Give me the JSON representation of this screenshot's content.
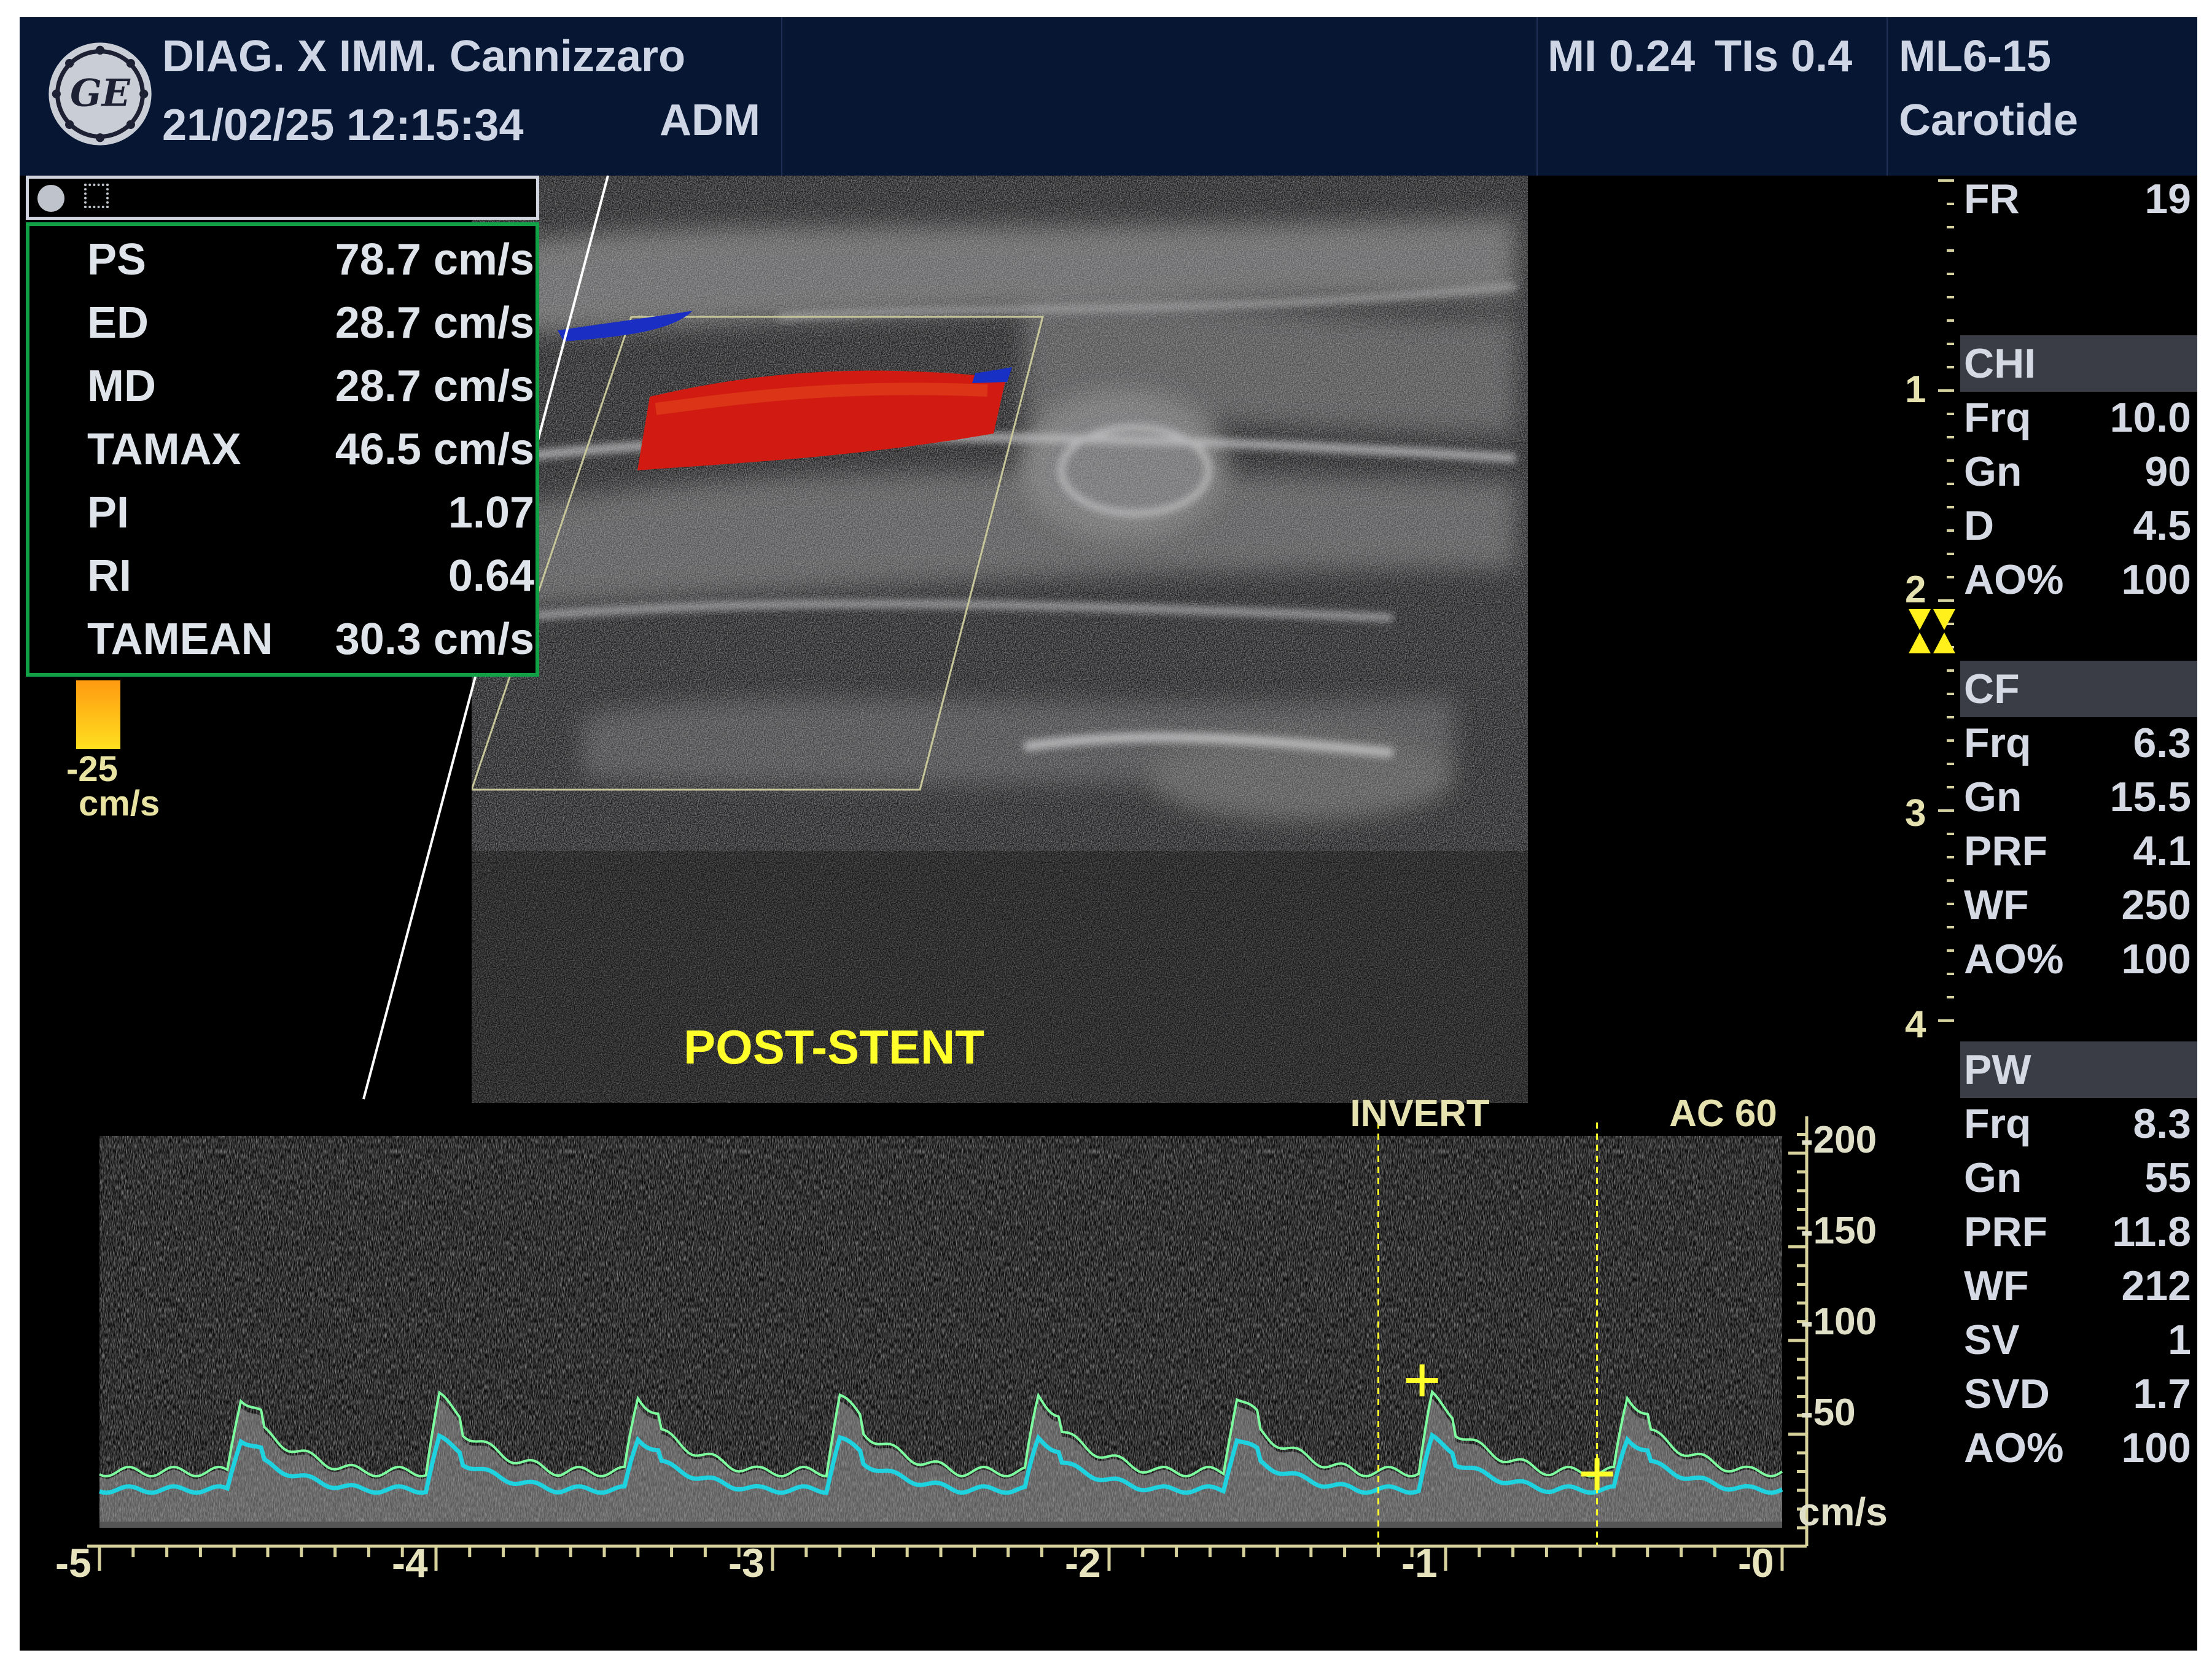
{
  "header": {
    "institution": "DIAG. X IMM. Cannizzaro",
    "datetime": "21/02/25 12:15:34",
    "operator": "ADM",
    "mi": "MI 0.24",
    "tis": "TIs 0.4",
    "probe": "ML6-15",
    "preset": "Carotide"
  },
  "logo_text": "GE",
  "measurements": [
    {
      "label": "PS",
      "value": "78.7 cm/s"
    },
    {
      "label": "ED",
      "value": "28.7 cm/s"
    },
    {
      "label": "MD",
      "value": "28.7 cm/s"
    },
    {
      "label": "TAMAX",
      "value": "46.5 cm/s"
    },
    {
      "label": "PI",
      "value": "1.07"
    },
    {
      "label": "RI",
      "value": "0.64"
    },
    {
      "label": "TAMEAN",
      "value": "30.3 cm/s"
    }
  ],
  "color_scale": {
    "min": "-25",
    "unit": "cm/s"
  },
  "image_annotation": "POST-STENT",
  "doppler": {
    "invert": "INVERT",
    "ac": "AC 60",
    "unit": "cm/s",
    "velocity_ticks": [
      "-200",
      "-150",
      "-100",
      "-50"
    ],
    "velocity_tick_values": [
      -200,
      -150,
      -100,
      -50
    ],
    "time_ticks": [
      "-5",
      "-4",
      "-3",
      "-2",
      "-1",
      "-0"
    ],
    "time_tick_values": [
      -5,
      -4,
      -3,
      -2,
      -1,
      0
    ],
    "cursor_times": [
      -1.2,
      -0.55
    ]
  },
  "depth_marks": [
    "1",
    "2",
    "3",
    "4"
  ],
  "side_panel": {
    "fr": {
      "label": "FR",
      "value": "19"
    },
    "chi": {
      "title": "CHI",
      "rows": [
        {
          "label": "Frq",
          "value": "10.0"
        },
        {
          "label": "Gn",
          "value": "90"
        },
        {
          "label": "D",
          "value": "4.5"
        },
        {
          "label": "AO%",
          "value": "100"
        }
      ]
    },
    "cf": {
      "title": "CF",
      "rows": [
        {
          "label": "Frq",
          "value": "6.3"
        },
        {
          "label": "Gn",
          "value": "15.5"
        },
        {
          "label": "PRF",
          "value": "4.1"
        },
        {
          "label": "WF",
          "value": "250"
        },
        {
          "label": "AO%",
          "value": "100"
        }
      ]
    },
    "pw": {
      "title": "PW",
      "rows": [
        {
          "label": "Frq",
          "value": "8.3"
        },
        {
          "label": "Gn",
          "value": "55"
        },
        {
          "label": "PRF",
          "value": "11.8"
        },
        {
          "label": "WF",
          "value": "212"
        },
        {
          "label": "SV",
          "value": "1"
        },
        {
          "label": "SVD",
          "value": "1.7"
        },
        {
          "label": "AO%",
          "value": "100"
        }
      ]
    }
  },
  "colors": {
    "header_bg": "#071633",
    "measure_border": "#12a046",
    "annotation": "#ffff2a",
    "trace_peak": "#7dffa0",
    "trace_mean": "#1fd2e0",
    "scale_line": "#d7d29c"
  }
}
